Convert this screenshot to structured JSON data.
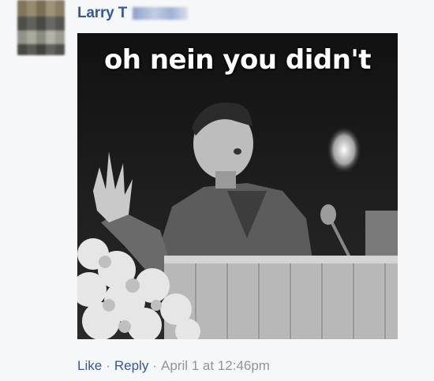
{
  "comment": {
    "author_name": "Larry T",
    "image_caption": "oh nein you didn't",
    "actions": {
      "like_label": "Like",
      "reply_label": "Reply",
      "separator": "·",
      "timestamp": "April 1 at 12:46pm"
    }
  },
  "colors": {
    "link": "#365899",
    "meta": "#90949c",
    "background": "#f6f7f9"
  }
}
